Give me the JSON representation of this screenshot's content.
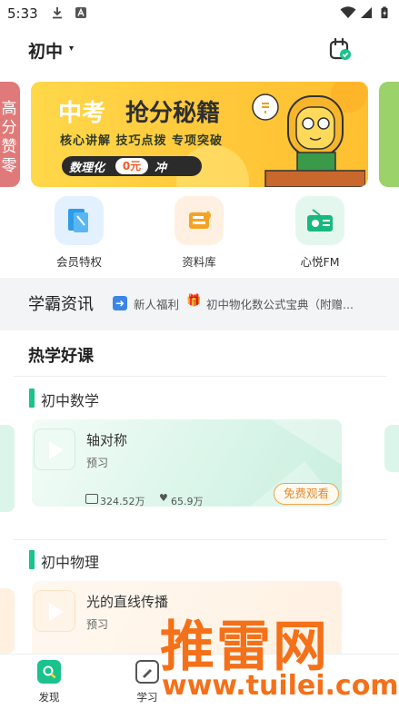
{
  "status_bar": {
    "time": "5:33"
  },
  "header": {
    "grade": "初中",
    "caret": "▾"
  },
  "banner": {
    "left_text": [
      "高",
      "分",
      "赞",
      "零"
    ],
    "title_part1": "中考",
    "title_part2": "抢分秘籍",
    "subtitle": "核心讲解 技巧点拨 专项突破",
    "pill_part1": "数理化",
    "pill_price": "0元",
    "pill_part3": "冲",
    "colors": {
      "bg": "#ffd84a",
      "accent": "#f05a28"
    }
  },
  "quick_entries": [
    {
      "label": "会员特权",
      "icon": "membership-card-icon",
      "color": "#e3f1ff"
    },
    {
      "label": "资料库",
      "icon": "document-library-icon",
      "color": "#fff0e1"
    },
    {
      "label": "心悦FM",
      "icon": "radio-fm-icon",
      "color": "#e3f7ef"
    }
  ],
  "news": {
    "title": "学霸资讯",
    "items": [
      "新人福利",
      "初中物化数公式宝典（附赠..."
    ]
  },
  "hot_courses": {
    "title": "热学好课",
    "subjects": [
      {
        "name": "初中数学",
        "course": {
          "title": "轴对称",
          "tag": "预习",
          "views": "324.52万",
          "likes": "65.9万",
          "button": "免费观看"
        }
      },
      {
        "name": "初中物理",
        "course": {
          "title": "光的直线传播",
          "tag": "预习"
        }
      }
    ]
  },
  "bottom_nav": {
    "items": [
      {
        "label": "发现",
        "icon": "discover-icon"
      },
      {
        "label": "学习",
        "icon": "study-icon"
      }
    ]
  },
  "watermark": {
    "text": "推雷网",
    "url": "www.tuilei.com"
  }
}
